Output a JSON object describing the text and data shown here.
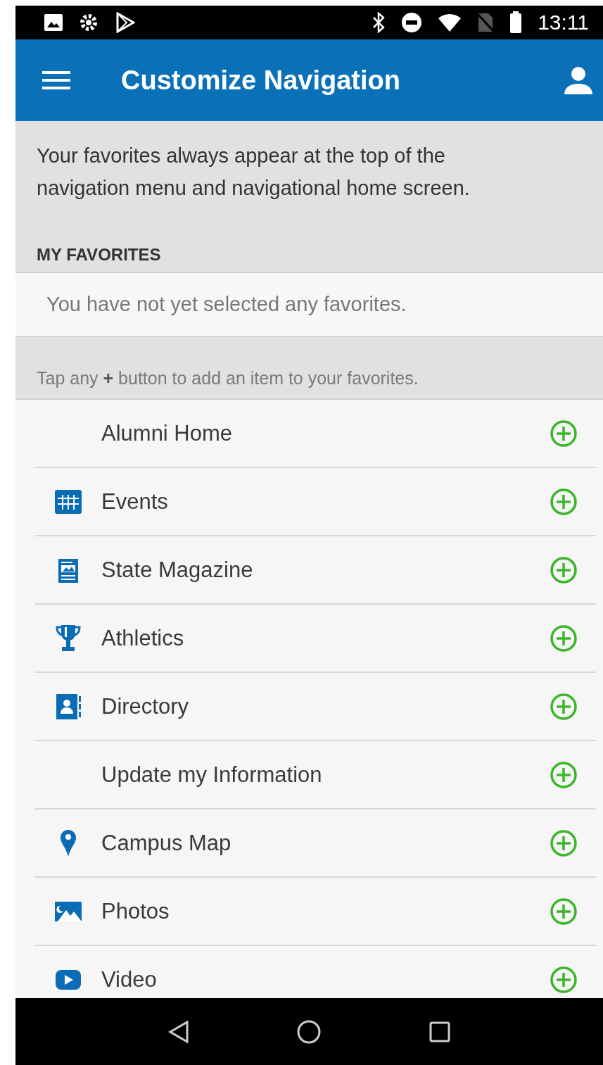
{
  "status_bar": {
    "time": "13:11"
  },
  "app_bar": {
    "title": "Customize Navigation"
  },
  "intro": "Your favorites always appear at the top of the navigation menu and navigational home screen.",
  "favorites": {
    "heading": "MY FAVORITES",
    "empty_message": "You have not yet selected any favorites."
  },
  "hint": "Tap any **+** button to add an item to your favorites.",
  "items": [
    {
      "label": "Alumni Home",
      "kind": "plain"
    },
    {
      "label": "Events",
      "kind": "calendar"
    },
    {
      "label": "State Magazine",
      "kind": "newspaper"
    },
    {
      "label": "Athletics",
      "kind": "trophy"
    },
    {
      "label": "Directory",
      "kind": "directory"
    },
    {
      "label": "Update my Information",
      "kind": "plain"
    },
    {
      "label": "Campus Map",
      "kind": "pin"
    },
    {
      "label": "Photos",
      "kind": "photo"
    },
    {
      "label": "Video",
      "kind": "video"
    }
  ]
}
